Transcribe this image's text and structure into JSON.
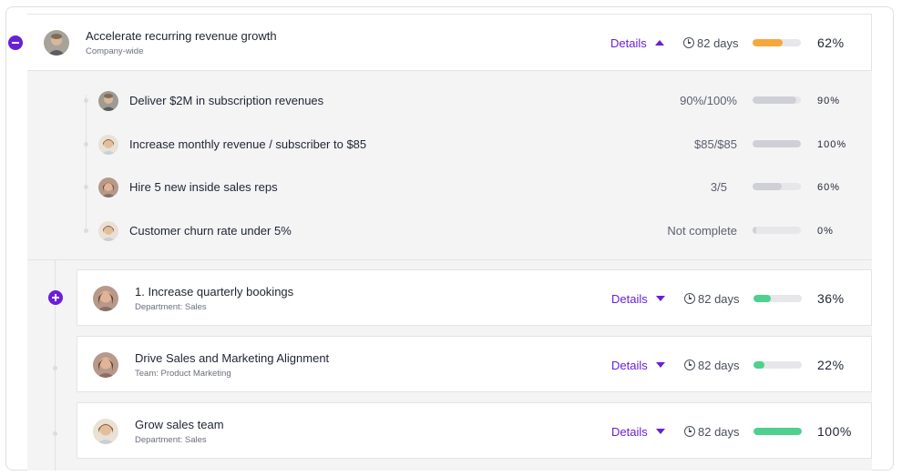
{
  "objective": {
    "title": "Accelerate recurring revenue growth",
    "subtitle": "Company-wide",
    "details_label": "Details",
    "days": "82 days",
    "percent": "62%",
    "progress": 0.62,
    "bar_color": "#f8a73c"
  },
  "key_results": [
    {
      "title": "Deliver $2M in subscription revenues",
      "progress_text": "90%/100%",
      "percent": "90%",
      "progress": 0.9,
      "bar_color": "#cfcfd8"
    },
    {
      "title": "Increase monthly revenue / subscriber to $85",
      "progress_text": "$85/$85",
      "percent": "100%",
      "progress": 1.0,
      "bar_color": "#cfcfd8"
    },
    {
      "title": "Hire 5 new inside sales reps",
      "progress_text": "3/5",
      "percent": "60%",
      "progress": 0.6,
      "bar_color": "#cfcfd8"
    },
    {
      "title": "Customer churn rate under 5%",
      "progress_text": "Not complete",
      "percent": "0%",
      "progress": 0.0,
      "bar_color": "#cfcfd8"
    }
  ],
  "child_objectives": [
    {
      "title": "1. Increase quarterly bookings",
      "subtitle": "Department: Sales",
      "details_label": "Details",
      "days": "82 days",
      "percent": "36%",
      "progress": 0.36,
      "bar_color": "#4fd08e"
    },
    {
      "title": "Drive Sales and Marketing Alignment",
      "subtitle": "Team: Product Marketing",
      "details_label": "Details",
      "days": "82 days",
      "percent": "22%",
      "progress": 0.22,
      "bar_color": "#4fd08e"
    },
    {
      "title": "Grow sales team",
      "subtitle": "Department: Sales",
      "details_label": "Details",
      "days": "82 days",
      "percent": "100%",
      "progress": 1.0,
      "bar_color": "#4fd08e"
    }
  ]
}
